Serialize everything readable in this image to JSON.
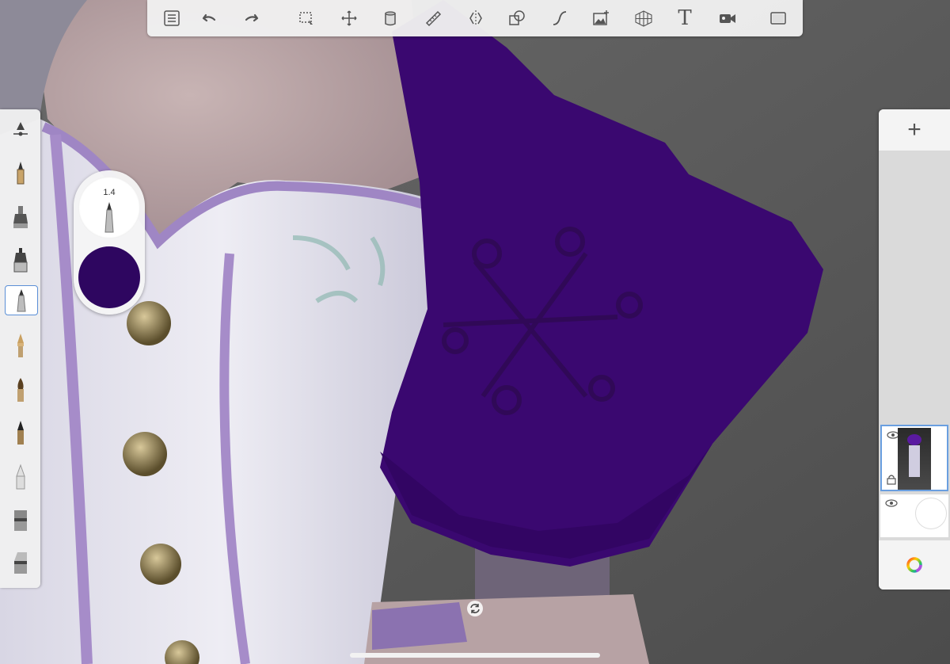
{
  "colors": {
    "active_color": "#2e0660",
    "canvas_background": "#5a5a5a",
    "hat": "#3a0870",
    "toolbar_bg": "#f0f0f0",
    "active_border": "#5b8fd6"
  },
  "toolbar": {
    "items": [
      {
        "name": "menu",
        "icon": "list-icon"
      },
      {
        "name": "undo",
        "icon": "undo-arrow-icon"
      },
      {
        "name": "redo",
        "icon": "redo-arrow-icon"
      },
      {
        "name": "selection",
        "icon": "selection-icon"
      },
      {
        "name": "transform",
        "icon": "move-icon"
      },
      {
        "name": "fill",
        "icon": "fill-bucket-icon"
      },
      {
        "name": "ruler",
        "icon": "ruler-icon"
      },
      {
        "name": "symmetry",
        "icon": "symmetry-icon"
      },
      {
        "name": "shapes",
        "icon": "shapes-icon"
      },
      {
        "name": "curve",
        "icon": "curve-icon"
      },
      {
        "name": "import-image",
        "icon": "image-add-icon"
      },
      {
        "name": "perspective",
        "icon": "perspective-grid-icon"
      },
      {
        "name": "text",
        "icon": "text-icon"
      },
      {
        "name": "record",
        "icon": "video-camera-icon"
      },
      {
        "name": "fullscreen",
        "icon": "fullscreen-icon"
      }
    ],
    "text_tool_label": "T"
  },
  "brush_size": {
    "value": "1.4"
  },
  "brushes": [
    {
      "name": "brush-properties",
      "icon": "brush-properties-icon"
    },
    {
      "name": "pencil",
      "icon": "pencil-icon"
    },
    {
      "name": "ink-pen",
      "icon": "ink-pen-icon"
    },
    {
      "name": "marker",
      "icon": "marker-icon"
    },
    {
      "name": "ballpoint",
      "icon": "ballpoint-icon",
      "active": true
    },
    {
      "name": "fountain-pen",
      "icon": "fountain-pen-icon"
    },
    {
      "name": "paint-brush",
      "icon": "paint-brush-icon"
    },
    {
      "name": "airbrush",
      "icon": "airbrush-icon"
    },
    {
      "name": "soft-eraser",
      "icon": "soft-eraser-icon"
    },
    {
      "name": "smudge",
      "icon": "smudge-icon"
    },
    {
      "name": "eraser",
      "icon": "eraser-icon"
    }
  ],
  "layers": {
    "add_label": "+",
    "items": [
      {
        "name": "character-layer",
        "visible": true,
        "active": true
      },
      {
        "name": "background-layer",
        "visible": true,
        "active": false
      }
    ]
  }
}
